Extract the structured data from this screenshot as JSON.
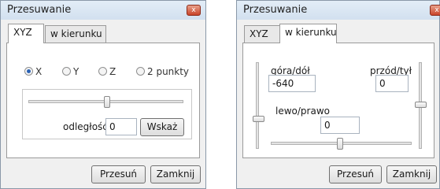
{
  "windows": [
    {
      "title": "Przesuwanie",
      "close_glyph": "x",
      "tabs": [
        "XYZ",
        "w kierunku"
      ],
      "active_tab": "XYZ",
      "radios": [
        {
          "label": "X",
          "selected": true
        },
        {
          "label": "Y",
          "selected": false
        },
        {
          "label": "Z",
          "selected": false
        },
        {
          "label": "2 punkty",
          "selected": false
        }
      ],
      "distance_label": "odległość",
      "distance_value": "0",
      "point_button": "Wskaż",
      "buttons": {
        "move": "Przesuń",
        "close": "Zamknij"
      }
    },
    {
      "title": "Przesuwanie",
      "close_glyph": "x",
      "tabs": [
        "XYZ",
        "w kierunku"
      ],
      "active_tab": "w kierunku",
      "up_down_label": "góra/dół",
      "up_down_value": "-640",
      "front_back_label": "przód/tył",
      "front_back_value": "0",
      "left_right_label": "lewo/prawo",
      "left_right_value": "0",
      "buttons": {
        "move": "Przesuń",
        "close": "Zamknij"
      }
    }
  ],
  "colors": {
    "radio_selected": "#2a62b4",
    "close_button": "#c9442a"
  },
  "icons": {
    "close": "close-icon"
  }
}
